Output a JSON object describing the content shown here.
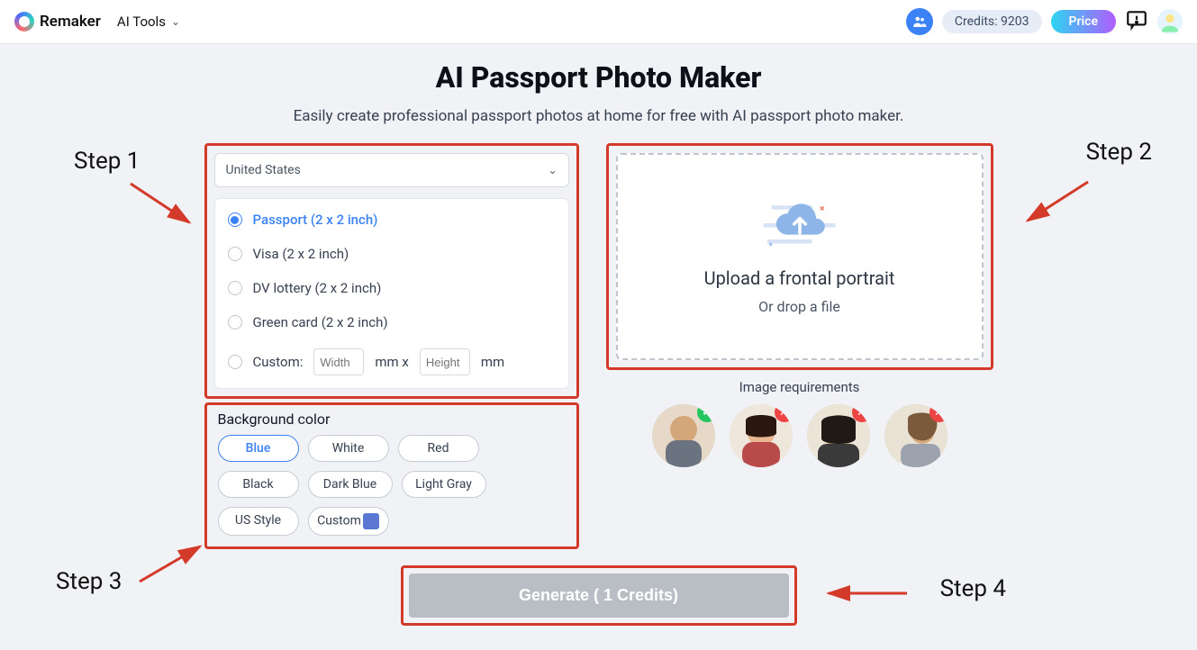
{
  "header": {
    "brand": "Remaker",
    "ai_tools_label": "AI Tools",
    "credits_label": "Credits: 9203",
    "price_label": "Price"
  },
  "page": {
    "title": "AI Passport Photo Maker",
    "subtitle": "Easily create professional passport photos at home for free with AI passport photo maker."
  },
  "steps": {
    "s1": "Step 1",
    "s2": "Step 2",
    "s3": "Step 3",
    "s4": "Step 4"
  },
  "country": {
    "selected": "United States"
  },
  "doc_types": {
    "items": [
      {
        "label": "Passport (2 x 2 inch)",
        "selected": true
      },
      {
        "label": "Visa (2 x 2 inch)",
        "selected": false
      },
      {
        "label": "DV lottery (2 x 2 inch)",
        "selected": false
      },
      {
        "label": "Green card (2 x 2 inch)",
        "selected": false
      }
    ],
    "custom_label": "Custom:",
    "width_placeholder": "Width",
    "height_placeholder": "Height",
    "mm_x": "mm x",
    "mm": "mm"
  },
  "background": {
    "label": "Background color",
    "options": [
      {
        "label": "Blue",
        "selected": true
      },
      {
        "label": "White",
        "selected": false
      },
      {
        "label": "Red",
        "selected": false
      },
      {
        "label": "Black",
        "selected": false
      },
      {
        "label": "Dark Blue",
        "selected": false
      },
      {
        "label": "Light Gray",
        "selected": false
      },
      {
        "label": "US Style",
        "selected": false
      },
      {
        "label": "Custom",
        "selected": false,
        "swatch": "#5a78d1"
      }
    ]
  },
  "upload": {
    "title": "Upload a frontal portrait",
    "subtitle": "Or drop a file"
  },
  "requirements": {
    "label": "Image requirements",
    "items": [
      {
        "ok": true
      },
      {
        "ok": false
      },
      {
        "ok": false
      },
      {
        "ok": false
      }
    ]
  },
  "generate": {
    "label": "Generate ( 1 Credits)"
  }
}
